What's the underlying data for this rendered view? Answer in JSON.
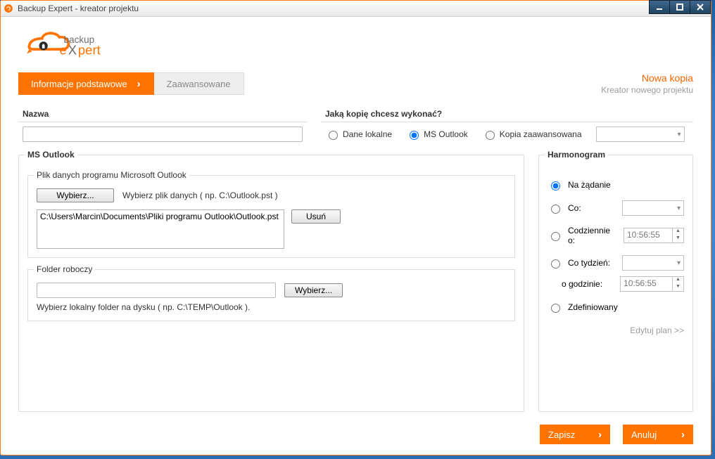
{
  "window_title": "Backup Expert - kreator projektu",
  "logo": {
    "brand1": "backup",
    "brand2": "eXpert"
  },
  "tabs": {
    "basic": "Informacje podstawowe",
    "advanced": "Zaawansowane",
    "active": "basic"
  },
  "header_right": {
    "new_copy": "Nowa kopia",
    "wizard_label": "Kreator nowego projektu"
  },
  "name_section": {
    "label": "Nazwa",
    "value": ""
  },
  "copy_type": {
    "label": "Jaką kopię chcesz wykonać?",
    "options": {
      "local": "Dane lokalne",
      "outlook": "MS Outlook",
      "advanced": "Kopia zaawansowana"
    },
    "selected": "outlook",
    "advanced_select_value": ""
  },
  "outlook_section": {
    "label": "MS Outlook",
    "datafile_legend": "Plik danych programu Microsoft Outlook",
    "choose_btn": "Wybierz...",
    "choose_hint": "Wybierz plik danych ( np. C:\\Outlook.pst )",
    "path": "C:\\Users\\Marcin\\Documents\\Pliki programu Outlook\\Outlook.pst",
    "delete_btn": "Usuń",
    "workdir_legend": "Folder roboczy",
    "workdir_value": "",
    "workdir_choose_btn": "Wybierz...",
    "workdir_hint": "Wybierz lokalny folder na dysku ( np. C:\\TEMP\\Outlook )."
  },
  "schedule": {
    "label": "Harmonogram",
    "options": {
      "on_demand": "Na żądanie",
      "every": "Co:",
      "daily_at": "Codziennie o:",
      "weekly": "Co tydzień:",
      "weekly_at_label": "o godzinie:",
      "defined": "Zdefiniowany"
    },
    "selected": "on_demand",
    "every_value": "",
    "daily_time": "10:56:55",
    "weekly_day": "",
    "weekly_time": "10:56:55",
    "edit_plan": "Edytuj plan >>"
  },
  "footer": {
    "save": "Zapisz",
    "cancel": "Anuluj"
  }
}
